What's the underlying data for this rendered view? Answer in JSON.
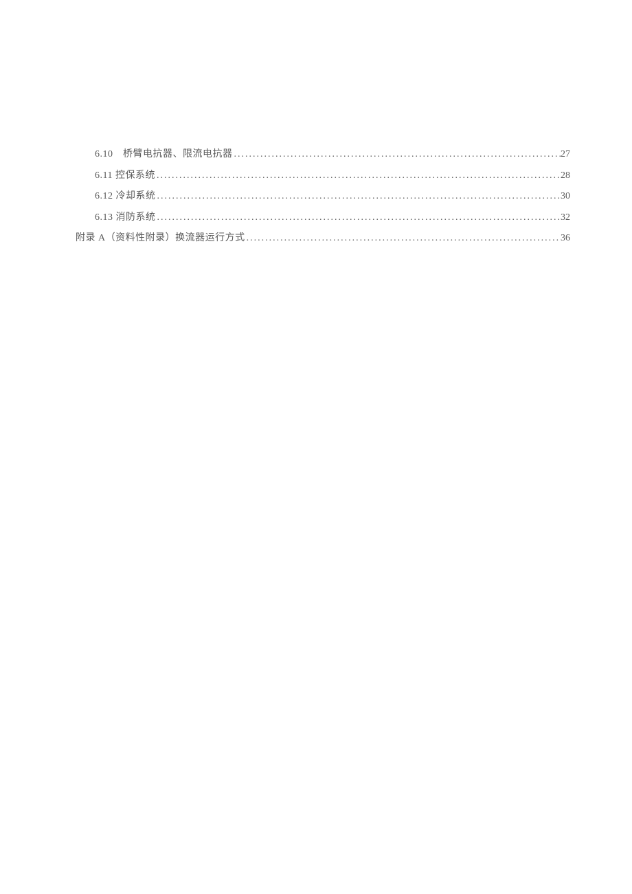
{
  "toc": {
    "entries": [
      {
        "indent": 1,
        "label": "6.10　桥臂电抗器、限流电抗器",
        "page": "27"
      },
      {
        "indent": 1,
        "label": "6.11 控保系统 ",
        "page": "28"
      },
      {
        "indent": 1,
        "label": "6.12 冷却系统 ",
        "page": "30"
      },
      {
        "indent": 1,
        "label": "6.13 消防系统 ",
        "page": "32"
      },
      {
        "indent": 0,
        "label": "附录 A（资料性附录）换流器运行方式 ",
        "page": "36"
      }
    ]
  }
}
